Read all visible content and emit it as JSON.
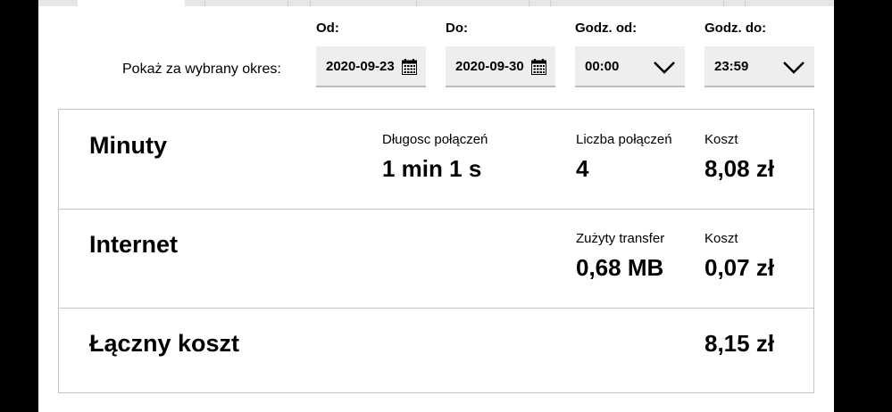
{
  "filter": {
    "label": "Pokaż za wybrany okres:",
    "from_label": "Od:",
    "from_value": "2020-09-23",
    "to_label": "Do:",
    "to_value": "2020-09-30",
    "time_from_label": "Godz. od:",
    "time_from_value": "00:00",
    "time_to_label": "Godz. do:",
    "time_to_value": "23:59"
  },
  "summary": {
    "minutes": {
      "title": "Minuty",
      "duration_label": "Długosc połączeń",
      "duration_value": "1 min 1 s",
      "count_label": "Liczba połączeń",
      "count_value": "4",
      "cost_label": "Koszt",
      "cost_value": "8,08 zł"
    },
    "internet": {
      "title": "Internet",
      "transfer_label": "Zużyty transfer",
      "transfer_value": "0,68 MB",
      "cost_label": "Koszt",
      "cost_value": "0,07 zł"
    },
    "total": {
      "title": "Łączny koszt",
      "value": "8,15 zł"
    }
  },
  "colors": {
    "field_bg": "#eeeeee",
    "border": "#c4c4c4",
    "text": "#000000"
  }
}
